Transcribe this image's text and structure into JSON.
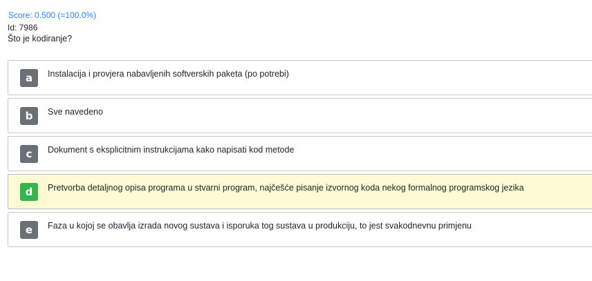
{
  "header": {
    "score": "Score: 0.500 (=100.0%)",
    "id": "Id: 7986",
    "question": "Što je kodiranje?"
  },
  "options": [
    {
      "letter": "a",
      "text": "Instalacija i provjera nabavljenih softverskih paketa (po potrebi)",
      "selected": false
    },
    {
      "letter": "b",
      "text": "Sve navedeno",
      "selected": false
    },
    {
      "letter": "c",
      "text": "Dokument s eksplicitnim instrukcijama kako napisati kod metode",
      "selected": false
    },
    {
      "letter": "d",
      "text": "Pretvorba detaljnog opisa programa u stvarni program, najčešće pisanje izvornog koda nekog formalnog programskog jezika",
      "selected": true
    },
    {
      "letter": "e",
      "text": "Faza u kojoj se obavlja izrada novog sustava i isporuka tog sustava u produkciju, to jest svakodnevnu primjenu",
      "selected": false
    }
  ],
  "colors": {
    "score": "#2f80ed",
    "letter_badge": "#6b7076",
    "letter_badge_correct": "#37b24d",
    "selected_background": "#fdfbd3"
  }
}
